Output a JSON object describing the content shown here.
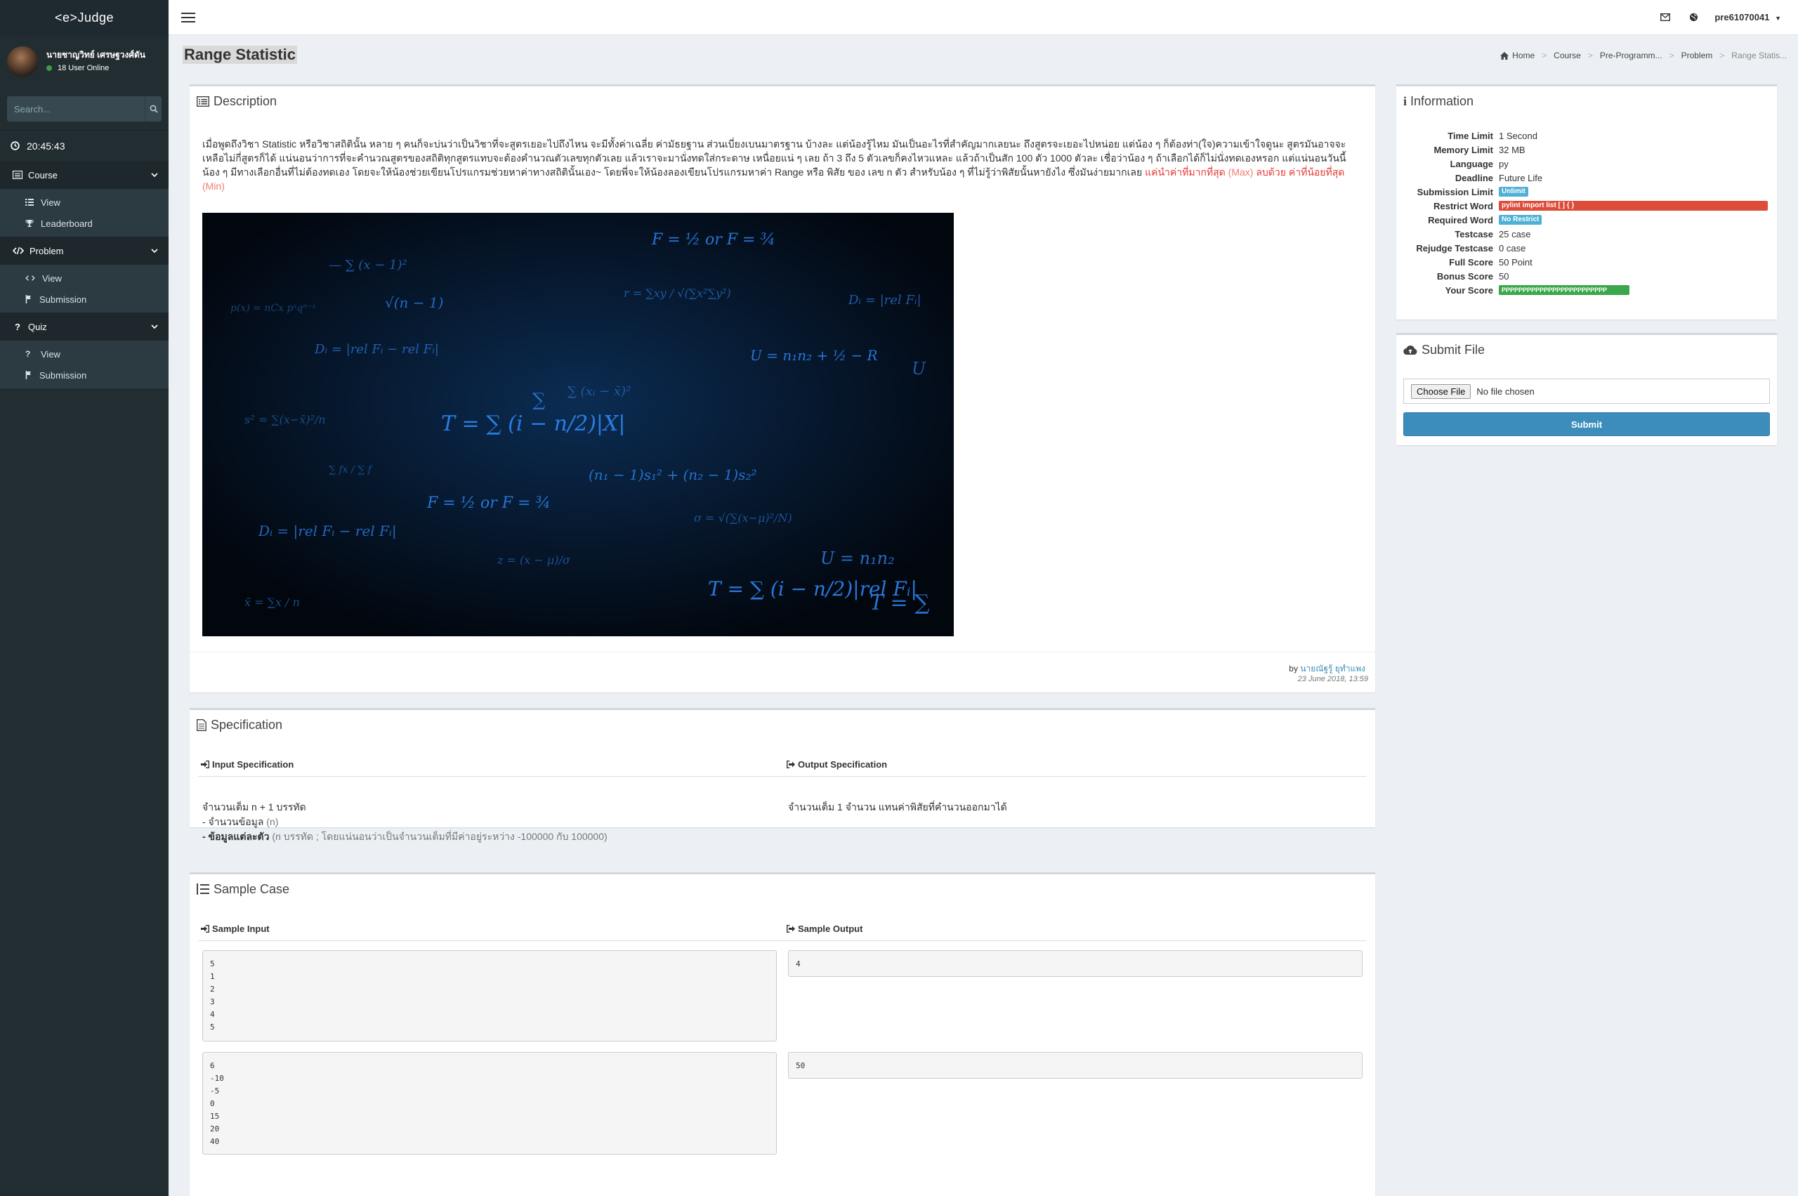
{
  "app": {
    "logo": "<e>Judge"
  },
  "user": {
    "name": "นายชาญวิทย์ เศรษฐวงศ์ดัน",
    "status": "18 User Online"
  },
  "search": {
    "placeholder": "Search..."
  },
  "clock": "20:45:43",
  "sidebar": {
    "sections": [
      {
        "label": "Course",
        "items": [
          "View",
          "Leaderboard"
        ]
      },
      {
        "label": "Problem",
        "items": [
          "View",
          "Submission"
        ]
      },
      {
        "label": "Quiz",
        "items": [
          "View",
          "Submission"
        ]
      }
    ]
  },
  "topbar": {
    "username": "pre61070041"
  },
  "page": {
    "title": "Range Statistic"
  },
  "breadcrumb": [
    "Home",
    "Course",
    "Pre-Programm...",
    "Problem",
    "Range Statis..."
  ],
  "description": {
    "title": "Description",
    "paragraph": "เมื่อพูดถึงวิชา Statistic หรือวิชาสถิตินั้น หลาย ๆ คนก็จะบ่นว่าเป็นวิชาที่จะสูตรเยอะไปถึงไหน จะมีทั้งค่าเฉลี่ย ค่ามัธยฐาน ส่วนเบี่ยงเบนมาตรฐาน บ้างละ แต่น้องรู้ไหม มันเป็นอะไรที่สำคัญมากเลยนะ ถึงสูตรจะเยอะไปหน่อย แต่น้อง ๆ ก็ต้องท่า(ใจ)ความเข้าใจดูนะ สูตรมันอาจจะเหลือไม่กี่สูตรก็ได้ แน่นอนว่าการที่จะคำนวณสูตรของสถิติทุกสูตรแทบจะต้องคำนวณตัวเลขทุกตัวเลย แล้วเราจะมานั่งทดใส่กระดาษ เหนื่อยแน่ ๆ เลย ถ้า 3 ถึง 5 ตัวเลขก็คงไหวแหละ แล้วถ้าเป็นสัก 100 ตัว 1000 ตัวละ เชื่อว่าน้อง ๆ ถ้าเลือกได้ก็ไม่นั่งทดเองหรอก แต่แน่นอนวันนี้น้อง ๆ มีทางเลือกอื่นที่ไม่ต้องทดเอง โดยจะให้น้องช่วยเขียนโปรแกรมช่วยหาค่าทางสถิตินั้นเอง~ โดยพี่จะให้น้องลองเขียนโปรแกรมหาค่า Range หรือ พิสัย ของ เลข n ตัว สำหรับน้อง ๆ ที่ไม่รู้ว่าพิสัยนั้นหายังไง ซึ่งมันง่ายมากเลย",
    "hl1": "แค่นำค่าที่มากที่สุด",
    "hl2": "(Max)",
    "hl3": "ลบด้วย",
    "hl4": "ค่าที่น้อยที่สุด",
    "hl5": "(Min)",
    "author_prefix": "by",
    "author": "นายณัฐรู้ ยุทำแพง",
    "date": "23 June 2018, 13:59"
  },
  "specification": {
    "title": "Specification",
    "input_head": "Input Specification",
    "output_head": "Output Specification",
    "input_line1": "จำนวนเต็ม n + 1 บรรทัด",
    "input_line2a": "- จำนวนข้อมูล",
    "input_line2b": "(n)",
    "input_line3a": "- ข้อมูลแต่ละตัว",
    "input_line3b": "(n บรรทัด ; โดยแน่นอนว่าเป็นจำนวนเต็มที่มีค่าอยู่ระหว่าง -100000 กับ 100000)",
    "output_line": "จำนวนเต็ม 1 จำนวน แทนค่าพิสัยที่คำนวนออกมาได้"
  },
  "sample": {
    "title": "Sample Case",
    "input_head": "Sample Input",
    "output_head": "Sample Output",
    "cases": [
      {
        "input": "5\n1\n2\n3\n4\n5",
        "output": "4"
      },
      {
        "input": "6\n-10\n-5\n0\n15\n20\n40",
        "output": "50"
      }
    ]
  },
  "information": {
    "title": "Information",
    "rows": [
      {
        "key": "Time Limit",
        "value": "1 Second"
      },
      {
        "key": "Memory Limit",
        "value": "32 MB"
      },
      {
        "key": "Language",
        "value": "py"
      },
      {
        "key": "Deadline",
        "value": "Future Life"
      },
      {
        "key": "Submission Limit",
        "badge": "Unlimit"
      },
      {
        "key": "Restrict Word",
        "badge": "pylint import list [ ] { }"
      },
      {
        "key": "Required Word",
        "badge": "No Restrict"
      },
      {
        "key": "Testcase",
        "value": "25 case"
      },
      {
        "key": "Rejudge Testcase",
        "value": "0 case"
      },
      {
        "key": "Full Score",
        "value": "50 Point"
      },
      {
        "key": "Bonus Score",
        "value": "50"
      },
      {
        "key": "Your Score",
        "badge": "PPPPPPPPPPPPPPPPPPPPPPPPP"
      }
    ]
  },
  "submit": {
    "title": "Submit File",
    "choose_label": "Choose File",
    "file_status": "No file chosen",
    "button": "Submit"
  },
  "colors": {
    "sidebar": "#222d32",
    "primary": "#3c8dbc",
    "danger": "#dd4b39",
    "success": "#3aa74a",
    "info": "#4fb0d6"
  }
}
